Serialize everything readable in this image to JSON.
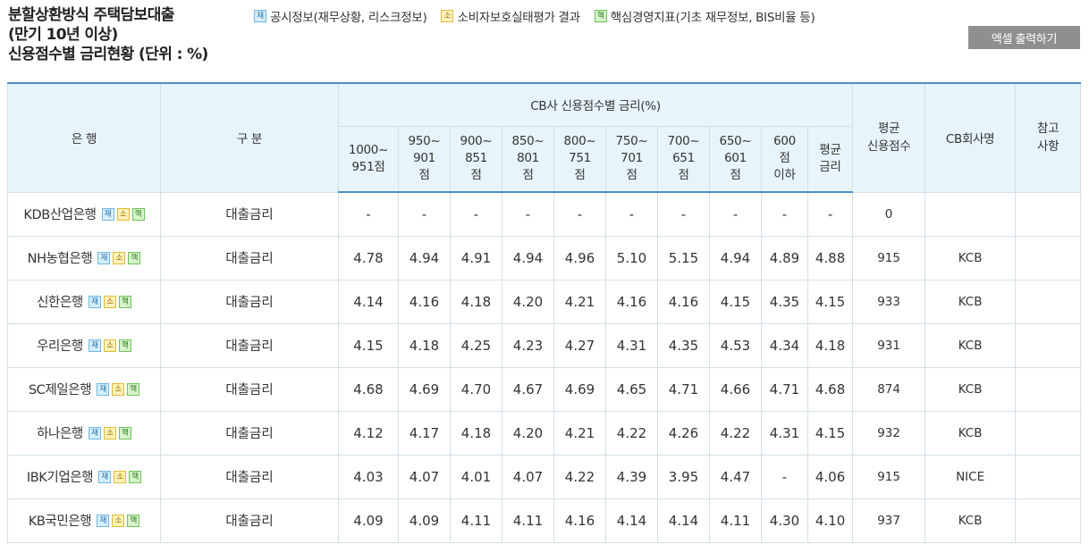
{
  "title": {
    "line1": "분할상환방식 주택담보대출",
    "line2": "(만기 10년 이상)",
    "line3": "신용점수별 금리현황 (단위 : %)"
  },
  "legend": [
    {
      "badge": "재",
      "label": "공시정보(재무상황, 리스크정보)"
    },
    {
      "badge": "소",
      "label": "소비자보호실태평가 결과"
    },
    {
      "badge": "핵",
      "label": "핵심경영지표(기초 재무정보, BIS비율 등)"
    }
  ],
  "excel_button": "엑셀 출력하기",
  "table": {
    "headers": {
      "bank": "은 행",
      "category": "구 분",
      "cb_group": "CB사 신용점수별 금리(%)",
      "avg_score": "평균\n신용점수",
      "cb_company": "CB회사명",
      "note": "참고\n사항"
    },
    "score_columns": [
      "1000~\n951점",
      "950~\n901\n점",
      "900~\n851\n점",
      "850~\n801\n점",
      "800~\n751\n점",
      "750~\n701\n점",
      "700~\n651\n점",
      "650~\n601\n점",
      "600\n점\n이하",
      "평균\n금리"
    ],
    "badges": [
      "재",
      "소",
      "핵"
    ],
    "rows": [
      {
        "bank": "KDB산업은행",
        "category": "대출금리",
        "rates": [
          "-",
          "-",
          "-",
          "-",
          "-",
          "-",
          "-",
          "-",
          "-",
          "-"
        ],
        "avg_score": "0",
        "cb": "",
        "note": ""
      },
      {
        "bank": "NH농협은행",
        "category": "대출금리",
        "rates": [
          "4.78",
          "4.94",
          "4.91",
          "4.94",
          "4.96",
          "5.10",
          "5.15",
          "4.94",
          "4.89",
          "4.88"
        ],
        "avg_score": "915",
        "cb": "KCB",
        "note": ""
      },
      {
        "bank": "신한은행",
        "category": "대출금리",
        "rates": [
          "4.14",
          "4.16",
          "4.18",
          "4.20",
          "4.21",
          "4.16",
          "4.16",
          "4.15",
          "4.35",
          "4.15"
        ],
        "avg_score": "933",
        "cb": "KCB",
        "note": ""
      },
      {
        "bank": "우리은행",
        "category": "대출금리",
        "rates": [
          "4.15",
          "4.18",
          "4.25",
          "4.23",
          "4.27",
          "4.31",
          "4.35",
          "4.53",
          "4.34",
          "4.18"
        ],
        "avg_score": "931",
        "cb": "KCB",
        "note": ""
      },
      {
        "bank": "SC제일은행",
        "category": "대출금리",
        "rates": [
          "4.68",
          "4.69",
          "4.70",
          "4.67",
          "4.69",
          "4.65",
          "4.71",
          "4.66",
          "4.71",
          "4.68"
        ],
        "avg_score": "874",
        "cb": "KCB",
        "note": ""
      },
      {
        "bank": "하나은행",
        "category": "대출금리",
        "rates": [
          "4.12",
          "4.17",
          "4.18",
          "4.20",
          "4.21",
          "4.22",
          "4.26",
          "4.22",
          "4.31",
          "4.15"
        ],
        "avg_score": "932",
        "cb": "KCB",
        "note": ""
      },
      {
        "bank": "IBK기업은행",
        "category": "대출금리",
        "rates": [
          "4.03",
          "4.07",
          "4.01",
          "4.07",
          "4.22",
          "4.39",
          "3.95",
          "4.47",
          "-",
          "4.06"
        ],
        "avg_score": "915",
        "cb": "NICE",
        "note": ""
      },
      {
        "bank": "KB국민은행",
        "category": "대출금리",
        "rates": [
          "4.09",
          "4.09",
          "4.11",
          "4.11",
          "4.16",
          "4.14",
          "4.14",
          "4.11",
          "4.30",
          "4.10"
        ],
        "avg_score": "937",
        "cb": "KCB",
        "note": ""
      }
    ]
  }
}
